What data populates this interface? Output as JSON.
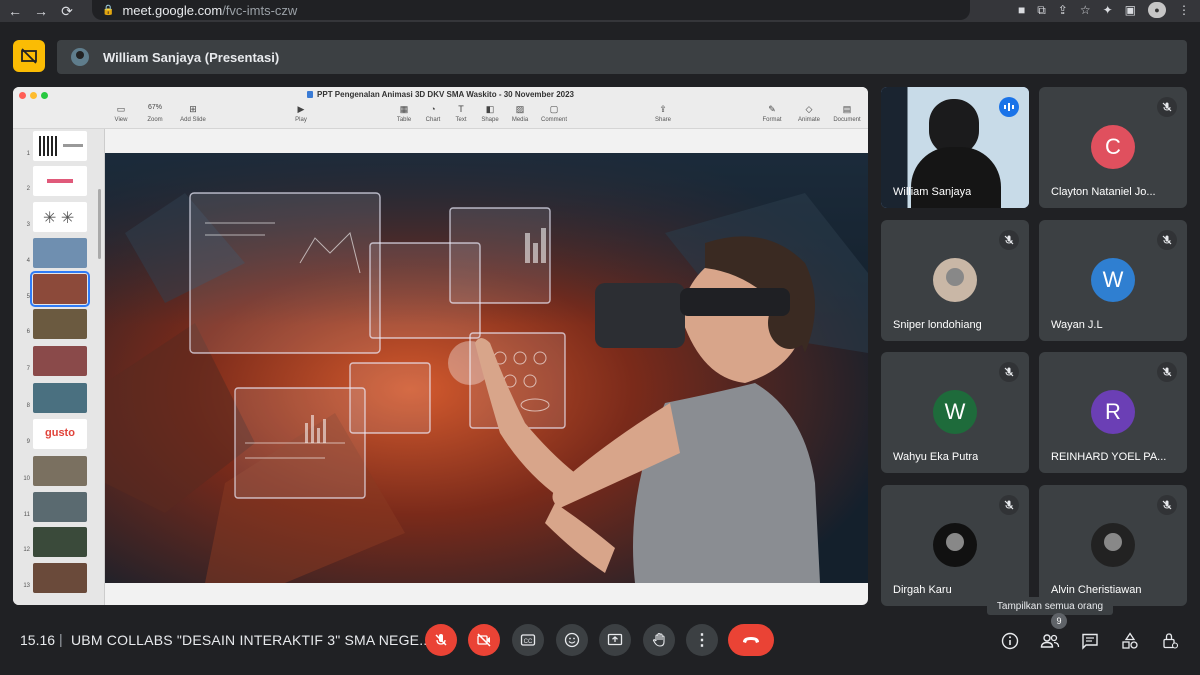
{
  "browser": {
    "url_host": "meet.google.com",
    "url_path": "/fvc-imts-czw"
  },
  "presenter_bar": {
    "label": "William Sanjaya (Presentasi)"
  },
  "keynote": {
    "doc_title": "PPT Pengenalan Animasi 3D DKV SMA Waskito - 30 November 2023",
    "zoom": "67%",
    "tools_left": [
      "View",
      "Zoom",
      "Add Slide"
    ],
    "play": "Play",
    "tools_mid": [
      "Table",
      "Chart",
      "Text",
      "Shape",
      "Media",
      "Comment"
    ],
    "share": "Share",
    "tools_right": [
      "Format",
      "Animate",
      "Document"
    ],
    "slide_numbers": [
      "1",
      "2",
      "3",
      "4",
      "5",
      "6",
      "7",
      "8",
      "9",
      "10",
      "11",
      "12",
      "13"
    ],
    "selected_slide": 5,
    "thumb9_text": "gusto"
  },
  "participants": [
    {
      "name": "William Sanjaya",
      "initial": "",
      "color": "#2d3e4f",
      "video": true,
      "speaking": true
    },
    {
      "name": "Clayton Nataniel Jo...",
      "initial": "C",
      "color": "#e0505e"
    },
    {
      "name": "Sniper londohiang",
      "initial": "",
      "color": "#c9b7a6",
      "photo": true
    },
    {
      "name": "Wayan J.L",
      "initial": "W",
      "color": "#2f7fd1"
    },
    {
      "name": "Wahyu Eka Putra",
      "initial": "W",
      "color": "#1e6b3b"
    },
    {
      "name": "REINHARD YOEL PA...",
      "initial": "R",
      "color": "#6b3fb5"
    },
    {
      "name": "Dirgah Karu",
      "initial": "",
      "color": "#111",
      "photo": true
    },
    {
      "name": "Alvin Cheristiawan",
      "initial": "",
      "color": "#222",
      "photo": true
    }
  ],
  "controls": {
    "time": "15.16",
    "separator": "|",
    "meeting_name": "UBM COLLABS \"DESAIN INTERAKTIF 3\" SMA NEGE...",
    "tooltip": "Tampilkan semua orang",
    "people_count": "9"
  },
  "colors": {
    "background": "#202124",
    "tile": "#3c4043",
    "danger": "#ea4335",
    "accent": "#8ab4f8",
    "present_icon": "#fbbc04"
  }
}
